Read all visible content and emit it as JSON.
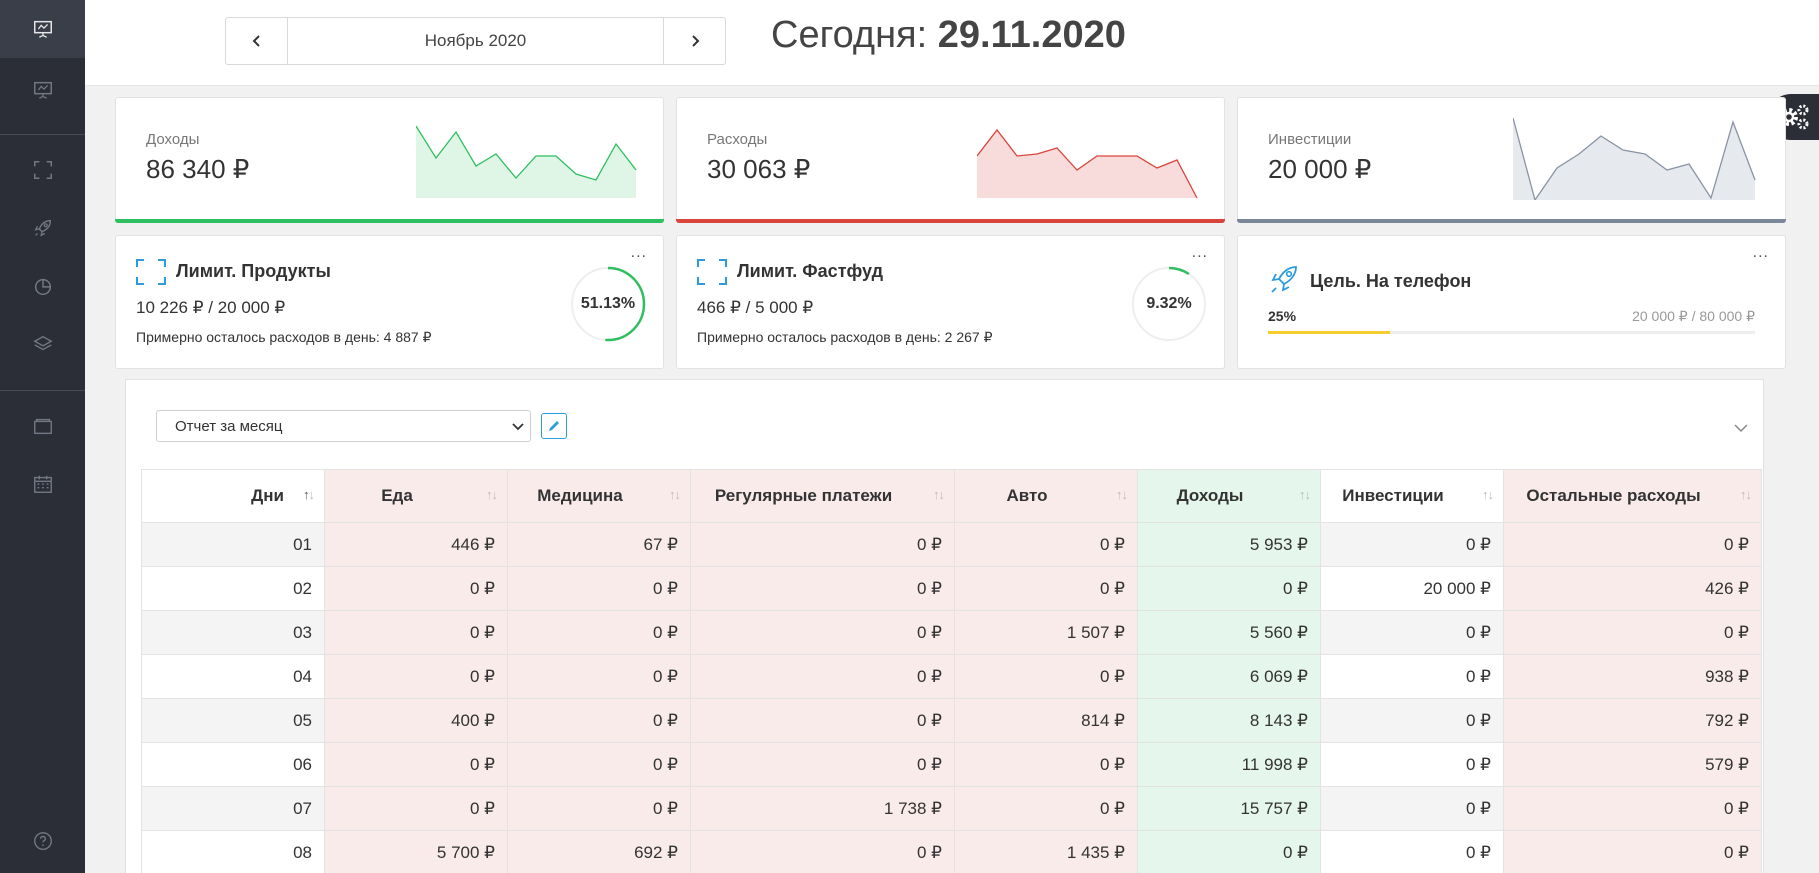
{
  "colors": {
    "income": "#2fbf60",
    "expense": "#d9453c",
    "investment": "#7a8799",
    "goal": "#f5cd2e",
    "accent": "#2d9cdb"
  },
  "sidebar": {
    "items": [
      {
        "icon": "presentation-icon",
        "active": true
      },
      {
        "icon": "presentation-icon",
        "active": false
      },
      {
        "icon": "scan-frame-icon",
        "active": false
      },
      {
        "icon": "rocket-icon",
        "active": false
      },
      {
        "icon": "pie-chart-icon",
        "active": false
      },
      {
        "icon": "layers-icon",
        "active": false
      },
      {
        "icon": "wallet-icon",
        "active": false
      },
      {
        "icon": "calendar-icon",
        "active": false
      },
      {
        "icon": "help-icon",
        "active": false
      }
    ]
  },
  "header": {
    "month": "Ноябрь 2020",
    "today_label": "Сегодня:",
    "today_date": "29.11.2020"
  },
  "summary": {
    "income": {
      "label": "Доходы",
      "value": "86 340 ₽"
    },
    "expense": {
      "label": "Расходы",
      "value": "30 063 ₽"
    },
    "investment": {
      "label": "Инвестиции",
      "value": "20 000 ₽"
    }
  },
  "limits": [
    {
      "title": "Лимит. Продукты",
      "amount": "10 226 ₽ / 20 000 ₽",
      "note": "Примерно осталось расходов в день: 4 887 ₽",
      "percent_label": "51.13%",
      "percent": 51.13
    },
    {
      "title": "Лимит. Фастфуд",
      "amount": "466 ₽ / 5 000 ₽",
      "note": "Примерно осталось расходов в день: 2 267 ₽",
      "percent_label": "9.32%",
      "percent": 9.32
    }
  ],
  "goal": {
    "title": "Цель. На телефон",
    "percent_label": "25%",
    "percent": 25,
    "amount": "20 000 ₽ / 80 000 ₽"
  },
  "more_label": "...",
  "report": {
    "selected": "Отчет за месяц",
    "columns": [
      "Дни",
      "Еда",
      "Медицина",
      "Регулярные платежи",
      "Авто",
      "Доходы",
      "Инвестиции",
      "Остальные расходы"
    ],
    "rows": [
      [
        "01",
        "446 ₽",
        "67 ₽",
        "0 ₽",
        "0 ₽",
        "5 953 ₽",
        "0 ₽",
        "0 ₽"
      ],
      [
        "02",
        "0 ₽",
        "0 ₽",
        "0 ₽",
        "0 ₽",
        "0 ₽",
        "20 000 ₽",
        "426 ₽"
      ],
      [
        "03",
        "0 ₽",
        "0 ₽",
        "0 ₽",
        "1 507 ₽",
        "5 560 ₽",
        "0 ₽",
        "0 ₽"
      ],
      [
        "04",
        "0 ₽",
        "0 ₽",
        "0 ₽",
        "0 ₽",
        "6 069 ₽",
        "0 ₽",
        "938 ₽"
      ],
      [
        "05",
        "400 ₽",
        "0 ₽",
        "0 ₽",
        "814 ₽",
        "8 143 ₽",
        "0 ₽",
        "792 ₽"
      ],
      [
        "06",
        "0 ₽",
        "0 ₽",
        "0 ₽",
        "0 ₽",
        "11 998 ₽",
        "0 ₽",
        "579 ₽"
      ],
      [
        "07",
        "0 ₽",
        "0 ₽",
        "1 738 ₽",
        "0 ₽",
        "15 757 ₽",
        "0 ₽",
        "0 ₽"
      ],
      [
        "08",
        "5 700 ₽",
        "692 ₽",
        "0 ₽",
        "1 435 ₽",
        "0 ₽",
        "0 ₽",
        "0 ₽"
      ]
    ]
  }
}
